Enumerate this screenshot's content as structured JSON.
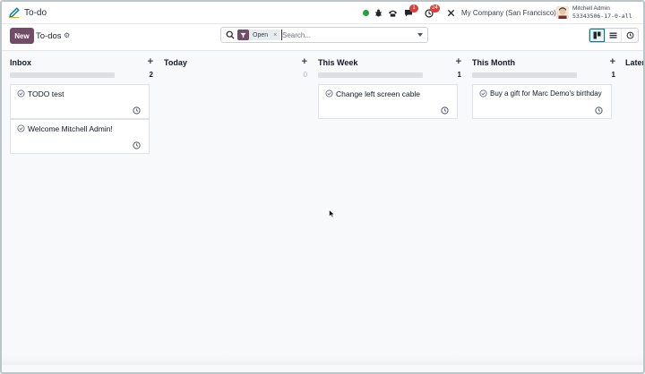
{
  "navbar": {
    "app_title": "To-do",
    "messages_badge": "1",
    "activities_badge": "24",
    "company": "My Company (San Francisco)",
    "user_name": "Mitchell Admin",
    "db_name": "533435​06-17-0-all"
  },
  "control": {
    "new_label": "New",
    "breadcrumb": "To-dos",
    "facet_label": "Open",
    "facet_remove": "×",
    "search_placeholder": "Search..."
  },
  "columns": [
    {
      "title": "Inbox",
      "count": "2",
      "cards": [
        {
          "title": "TODO test"
        },
        {
          "title": "Welcome Mitchell Admin!"
        }
      ]
    },
    {
      "title": "Today",
      "count": "0",
      "cards": []
    },
    {
      "title": "This Week",
      "count": "1",
      "cards": [
        {
          "title": "Change left screen cable"
        }
      ]
    },
    {
      "title": "This Month",
      "count": "1",
      "cards": [
        {
          "title": "Buy a gift for Marc Demo's birthday"
        }
      ]
    },
    {
      "title": "Later",
      "count": "",
      "cards": []
    }
  ],
  "colors": {
    "brand": "#714b67",
    "status_online": "#22a33a",
    "badge": "#d9413a",
    "active_view": "#017e84"
  },
  "icons": [
    "pencil-icon",
    "bug-icon",
    "phone-icon",
    "chat-icon",
    "clock-icon",
    "tools-icon",
    "gear-icon",
    "search-icon",
    "filter-icon",
    "kanban-view-icon",
    "list-view-icon",
    "activity-view-icon",
    "check-circle-icon"
  ]
}
